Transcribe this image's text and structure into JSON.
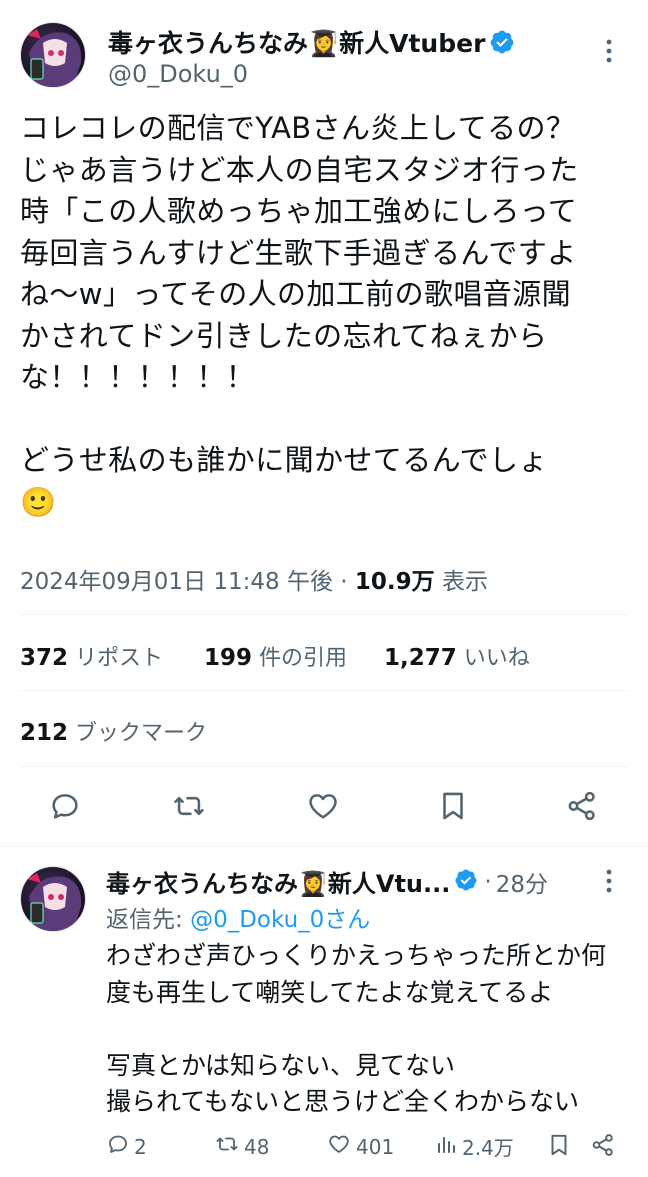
{
  "tweet": {
    "author_name": "毒ヶ衣うんちなみ👩‍🎓新人Vtuber",
    "handle": "@0_Doku_0",
    "body": "コレコレの配信でYABさん炎上してるの？\nじゃあ言うけど本人の自宅スタジオ行った\n時「この人歌めっちゃ加工強めにしろって\n毎回言うんすけど生歌下手過ぎるんですよ\nね〜w」ってその人の加工前の歌唱音源聞\nかされてドン引きしたの忘れてねぇから\nな！！！！！！！\n\nどうせ私のも誰かに聞かせてるんでしょ\n🙂",
    "timestamp": "2024年09月01日 11:48 午後",
    "separator": "·",
    "views": "10.9万",
    "views_label": "表示",
    "reposts_count": "372",
    "reposts_label": "リポスト",
    "quotes_count": "199",
    "quotes_label": "件の引用",
    "likes_count": "1,277",
    "likes_label": "いいね",
    "bookmarks_count": "212",
    "bookmarks_label": "ブックマーク"
  },
  "reply": {
    "author_name": "毒ヶ衣うんちなみ👩‍🎓新人Vtu...",
    "time_sep": "·",
    "time": "28分",
    "reply_to_prefix": "返信先: ",
    "reply_to_handle": "@0_Doku_0さん",
    "body": "わざわざ声ひっくりかえっちゃった所とか何\n度も再生して嘲笑してたよな覚えてるよ\n\n写真とかは知らない、見てない\n撮られてもないと思うけど全くわからない",
    "replies": "2",
    "reposts": "48",
    "likes": "401",
    "views": "2.4万"
  },
  "colors": {
    "text": "#0f1419",
    "secondary": "#536471",
    "accent": "#1d9bf0",
    "divider": "#eff3f4"
  }
}
